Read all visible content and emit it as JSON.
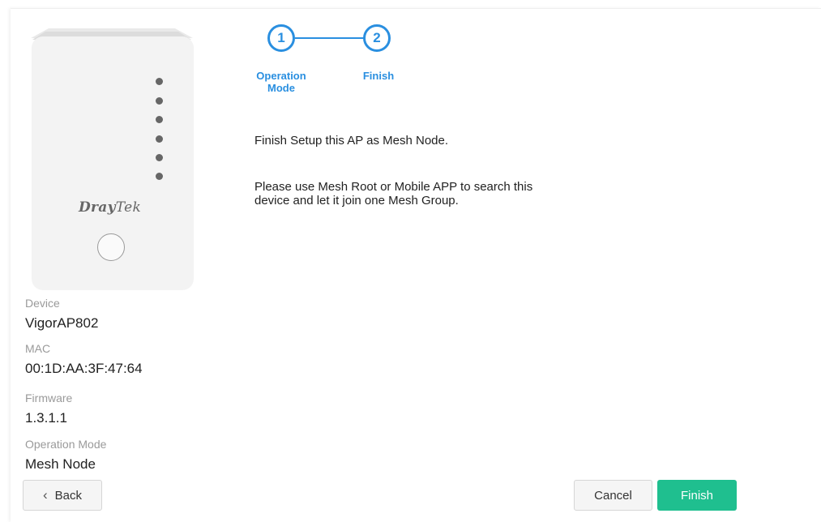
{
  "device_card": {
    "logo_bold": "Dray",
    "logo_rest": "Tek",
    "leds": 6
  },
  "info": {
    "device_label": "Device",
    "device_value": "VigorAP802",
    "mac_label": "MAC",
    "mac_value": "00:1D:AA:3F:47:64",
    "firmware_label": "Firmware",
    "firmware_value": "1.3.1.1",
    "mode_label": "Operation Mode",
    "mode_value": "Mesh Node"
  },
  "stepper": {
    "steps": [
      {
        "number": "1",
        "label_line1": "Operation",
        "label_line2": "Mode"
      },
      {
        "number": "2",
        "label_line1": "Finish",
        "label_line2": ""
      }
    ],
    "accent_color": "#2a8fe0"
  },
  "content": {
    "message1": "Finish Setup this AP as Mesh Node.",
    "message2_line1": "Please use Mesh Root or Mobile APP to search this",
    "message2_line2": "device and let it join one Mesh Group."
  },
  "buttons": {
    "back_icon": "chevron-left-icon",
    "back_label": "Back",
    "cancel_label": "Cancel",
    "finish_label": "Finish",
    "finish_color": "#1fbf8f"
  }
}
